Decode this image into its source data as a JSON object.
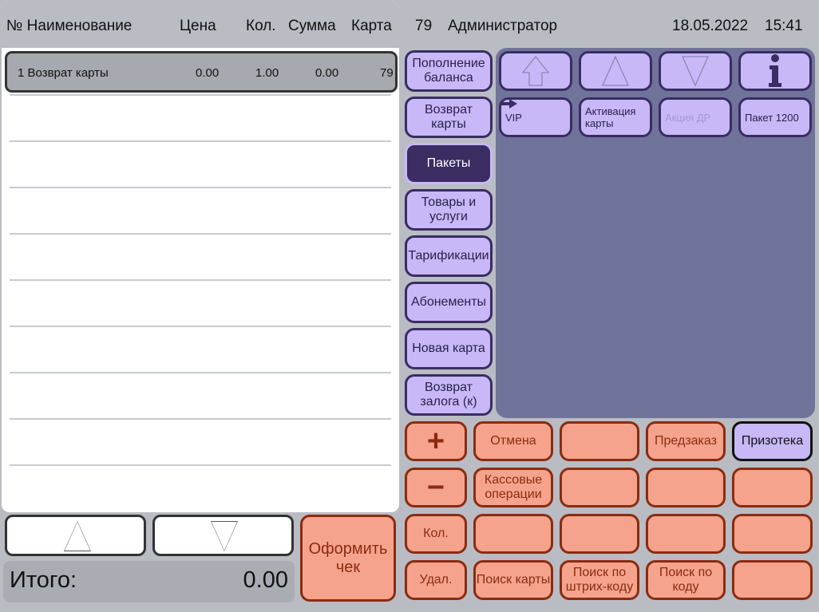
{
  "receipt": {
    "columns": {
      "name": "№ Наименование",
      "price": "Цена",
      "qty": "Кол.",
      "sum": "Сумма",
      "card": "Карта"
    },
    "rows": [
      {
        "num_name": "1 Возврат карты",
        "price": "0.00",
        "qty": "1.00",
        "sum": "0.00",
        "card": "79"
      }
    ]
  },
  "total": {
    "label": "Итого:",
    "value": "0.00"
  },
  "checkout": {
    "label": "Оформить чек"
  },
  "header": {
    "user_id": "79",
    "user_role": "Администратор",
    "date": "18.05.2022",
    "time": "15:41"
  },
  "categories": [
    {
      "label": "Пополнение баланса",
      "active": false
    },
    {
      "label": "Возврат карты",
      "active": false
    },
    {
      "label": "Пакеты",
      "active": true
    },
    {
      "label": "Товары и услуги",
      "active": false
    },
    {
      "label": "Тарификации",
      "active": false
    },
    {
      "label": "Абонементы",
      "active": false
    },
    {
      "label": "Новая карта",
      "active": false
    },
    {
      "label": "Возврат залога (к)",
      "active": false
    }
  ],
  "nav_icons": [
    "back-icon",
    "scroll-up-icon",
    "scroll-down-icon",
    "info-icon"
  ],
  "products": [
    {
      "label": "VIP",
      "enabled": true,
      "icon": "arrow-right-icon"
    },
    {
      "label": "Активация карты",
      "enabled": true
    },
    {
      "label": "Акция ДР",
      "enabled": false
    },
    {
      "label": "Пакет 1200",
      "enabled": true
    }
  ],
  "actions": {
    "plus": "+",
    "minus": "−",
    "cancel": "Отмена",
    "preorder": "Предзаказ",
    "prizoteka": "Призотека",
    "cash_ops": "Кассовые операции",
    "qty": "Кол.",
    "delete": "Удал.",
    "search_card": "Поиск карты",
    "search_barcode": "Поиск по штрих-коду",
    "search_code": "Поиск по коду"
  },
  "colors": {
    "accent": "#c8b8f7",
    "action": "#f6a38d",
    "panel": "#70749a",
    "active_category": "#3b2c62"
  }
}
